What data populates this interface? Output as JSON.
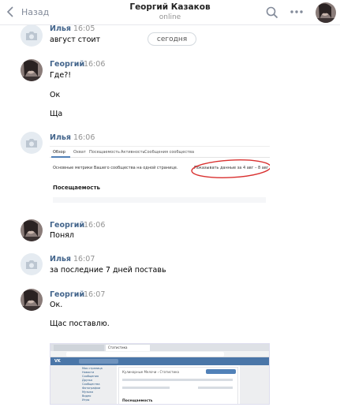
{
  "header": {
    "back_label": "Назад",
    "contact_name": "Георгий Казаков",
    "status": "online"
  },
  "date_divider": "сегодня",
  "messages": [
    {
      "author": "Илья",
      "time": "16:05",
      "lines": [
        "август стоит"
      ]
    },
    {
      "author": "Георгий",
      "time": "16:06",
      "lines": [
        "Где?!",
        "Ок",
        "Ща"
      ]
    },
    {
      "author": "Илья",
      "time": "16:06",
      "lines": []
    },
    {
      "author": "Георгий",
      "time": "16:06",
      "lines": [
        "Понял"
      ]
    },
    {
      "author": "Илья",
      "time": "16:07",
      "lines": [
        "за последние 7 дней поставь"
      ]
    },
    {
      "author": "Георгий",
      "time": "16:07",
      "lines": [
        "Ок.",
        "Щас поставлю."
      ]
    }
  ],
  "attachment1": {
    "tabs": [
      "Обзор",
      "Охват",
      "Посещаемость",
      "Активность",
      "Сообщения сообщества"
    ],
    "caption": "Основные метрики Вашего сообщества на одной странице.",
    "range": "Показывать данные за 4 авг – 8 авг",
    "section": "Посещаемость",
    "highlight_color": "#d9302f"
  },
  "attachment2": {
    "browser_tab": "Статистика",
    "breadcrumb": "Кулинарные Мелочи › Статистика",
    "section": "Посещаемость",
    "nav_items": [
      "Моя страница",
      "Новости",
      "Сообщения",
      "Друзья",
      "Сообщества",
      "Фотографии",
      "Музыка",
      "Видео",
      "Игры"
    ]
  },
  "colors": {
    "name": "#42648b",
    "accent": "#5181b8"
  }
}
